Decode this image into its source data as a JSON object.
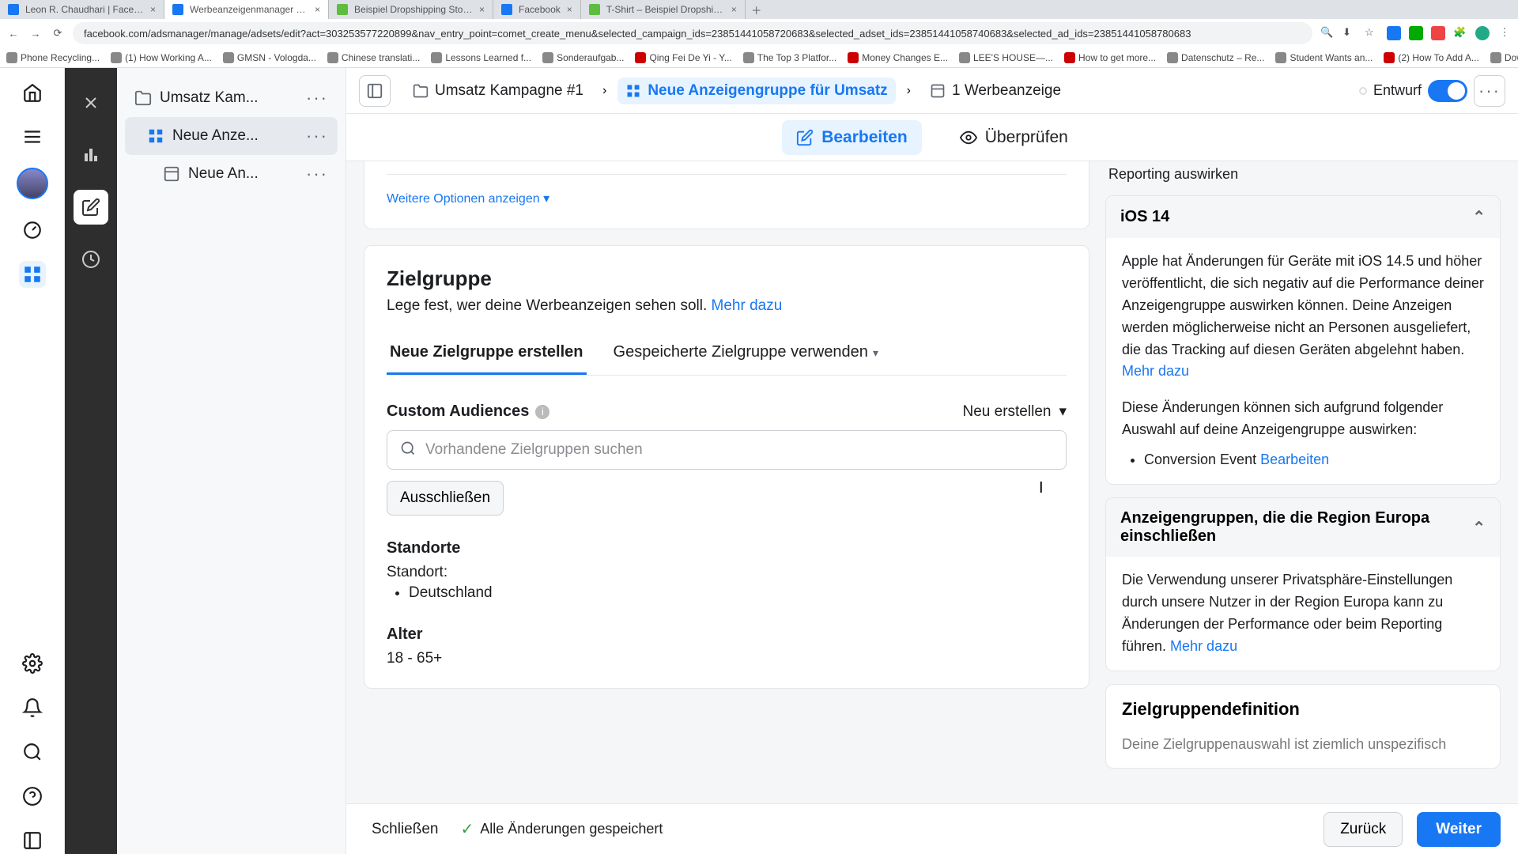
{
  "browser": {
    "tabs": [
      {
        "label": "Leon R. Chaudhari | Facebook"
      },
      {
        "label": "Werbeanzeigenmanager – We"
      },
      {
        "label": "Beispiel Dropshipping Store –"
      },
      {
        "label": "Facebook"
      },
      {
        "label": "T-Shirt – Beispiel Dropshippin"
      }
    ],
    "url": "facebook.com/adsmanager/manage/adsets/edit?act=303253577220899&nav_entry_point=comet_create_menu&selected_campaign_ids=23851441058720683&selected_adset_ids=23851441058740683&selected_ad_ids=23851441058780683",
    "bookmarks": [
      "Phone Recycling...",
      "(1) How Working A...",
      "GMSN - Vologda...",
      "Chinese translati...",
      "Lessons Learned f...",
      "Sonderaufgab...",
      "Qing Fei De Yi - Y...",
      "The Top 3 Platfor...",
      "Money Changes E...",
      "LEE'S HOUSE—...",
      "How to get more...",
      "Datenschutz – Re...",
      "Student Wants an...",
      "(2) How To Add A...",
      "Download - Cooki..."
    ]
  },
  "tree": {
    "campaign": "Umsatz Kam...",
    "adset": "Neue Anze...",
    "ad": "Neue An..."
  },
  "crumbs": {
    "campaign": "Umsatz Kampagne #1",
    "adset": "Neue Anzeigengruppe für Umsatz",
    "ad": "1 Werbeanzeige",
    "status": "Entwurf"
  },
  "edit_tabs": {
    "edit": "Bearbeiten",
    "review": "Überprüfen"
  },
  "show_more": "Weitere Optionen anzeigen",
  "zielgruppe": {
    "title": "Zielgruppe",
    "subtitle": "Lege fest, wer deine Werbeanzeigen sehen soll. ",
    "mehr": "Mehr dazu",
    "tab_new": "Neue Zielgruppe erstellen",
    "tab_saved": "Gespeicherte Zielgruppe verwenden",
    "custom_audiences": "Custom Audiences",
    "neu_erstellen": "Neu erstellen",
    "search_placeholder": "Vorhandene Zielgruppen suchen",
    "ausschliessen": "Ausschließen",
    "standorte": "Standorte",
    "standort_label": "Standort:",
    "standort_value": "Deutschland",
    "alter": "Alter",
    "alter_value": "18 - 65+"
  },
  "right": {
    "reporting_frag": "Reporting auswirken",
    "ios_title": "iOS 14",
    "ios_p1": "Apple hat Änderungen für Geräte mit iOS 14.5 und höher veröffentlicht, die sich negativ auf die Performance deiner Anzeigengruppe auswirken können. Deine Anzeigen werden möglicherweise nicht an Personen ausgeliefert, die das Tracking auf diesen Geräten abgelehnt haben. ",
    "ios_p2": "Diese Änderungen können sich aufgrund folgender Auswahl auf deine Anzeigengruppe auswirken:",
    "ios_bullet": "Conversion Event ",
    "bearbeiten": "Bearbeiten",
    "mehr": "Mehr dazu",
    "europa_title": "Anzeigengruppen, die die Region Europa einschließen",
    "europa_body": "Die Verwendung unserer Privatsphäre-Einstellungen durch unsere Nutzer in der Region Europa kann zu Änderungen der Performance oder beim Reporting führen. ",
    "zieldef": "Zielgruppendefinition",
    "zieldef_frag": "Deine Zielgruppenauswahl ist ziemlich unspezifisch"
  },
  "footer": {
    "close": "Schließen",
    "saved": "Alle Änderungen gespeichert",
    "back": "Zurück",
    "next": "Weiter"
  }
}
